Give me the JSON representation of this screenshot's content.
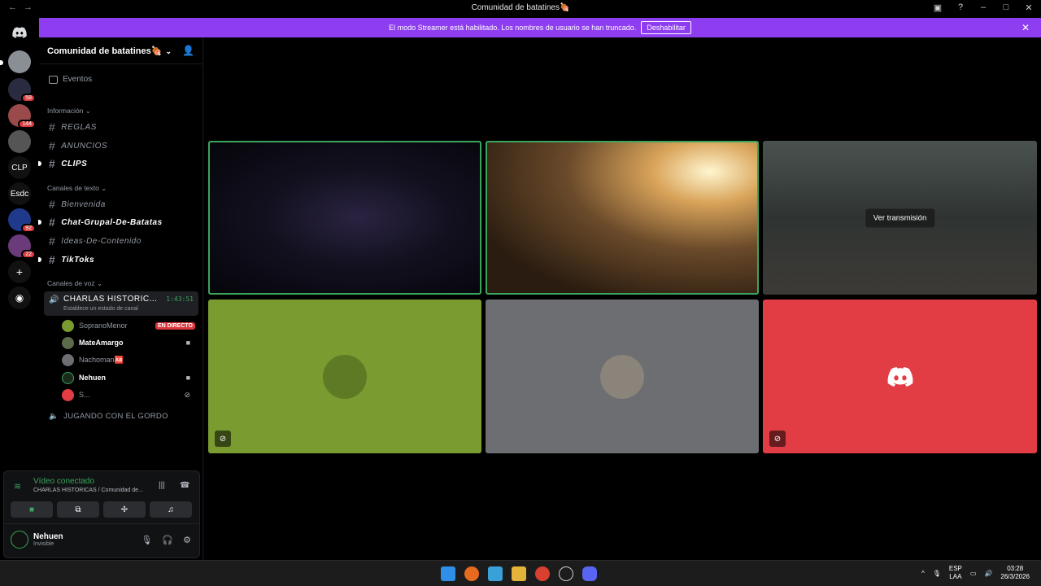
{
  "window": {
    "title": "Comunidad de batatines🍖",
    "back": "←",
    "forward": "→"
  },
  "banner": {
    "text": "El modo Streamer está habilitado. Los nombres de usuario se han truncado.",
    "button": "Deshabilitar"
  },
  "guilds": [
    {
      "label": "",
      "badge": ""
    },
    {
      "label": "",
      "badge": "58"
    },
    {
      "label": "",
      "badge": "144"
    },
    {
      "label": "",
      "badge": ""
    },
    {
      "label": "CLP",
      "badge": ""
    },
    {
      "label": "Esdc",
      "badge": ""
    },
    {
      "label": "",
      "badge": "92"
    },
    {
      "label": "",
      "badge": "22"
    }
  ],
  "server": {
    "name": "Comunidad de batatines🍖",
    "events": "Eventos",
    "categories": {
      "info": "Información",
      "text": "Canales de texto",
      "voice": "Canales de voz"
    },
    "info_channels": [
      "REGLAS",
      "ANUNCIOS",
      "CLIPS"
    ],
    "text_channels": [
      "Bienvenida",
      "Chat-Grupal-De-Batatas",
      "Ideas-De-Contenido",
      "TikToks"
    ],
    "voice_channel": {
      "name": "CHARLAS HISTORIC...",
      "timer": "1:43:51",
      "status": "Establece un estado de canal"
    },
    "members": [
      {
        "name": "SopranoMenor",
        "right": "EN DIRECTO"
      },
      {
        "name": "MateAmargo",
        "right": "▶"
      },
      {
        "name": "Nachoman🆎",
        "right": ""
      },
      {
        "name": "Nehuen",
        "right": "▶"
      },
      {
        "name": "S...",
        "right": ""
      }
    ],
    "voice_channel_2": "JUGANDO CON EL GORDO"
  },
  "voice_panel": {
    "status": "Vídeo conectado",
    "channel": "CHARLAS HISTORICAS / Comunidad de..."
  },
  "user": {
    "name": "Nehuen",
    "status": "Invisible"
  },
  "stage": {
    "watch_stream": "Ver transmisión",
    "colors": {
      "speaking": "#3ba55d",
      "tile_green": "#7a9b30",
      "tile_gray": "#6d6e72",
      "tile_red": "#e23c45",
      "accent": "#8f3df0"
    }
  },
  "taskbar": {
    "lang_top": "ESP",
    "lang_bottom": "LAA",
    "time": "03:28",
    "date": "26/3/2026"
  }
}
